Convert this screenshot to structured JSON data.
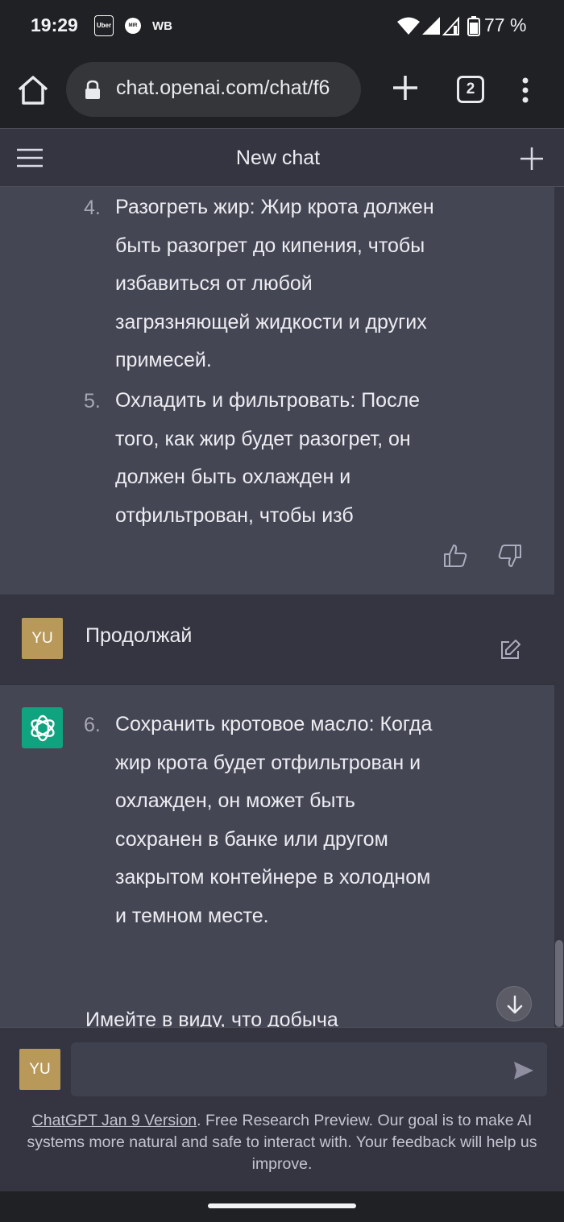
{
  "status_bar": {
    "time": "19:29",
    "notifications": [
      "Uber",
      "MIR",
      "WB"
    ],
    "battery": "77 %"
  },
  "browser": {
    "url": "chat.openai.com/chat/f6",
    "tab_count": "2"
  },
  "header": {
    "title": "New chat"
  },
  "conversation": {
    "ai_message_1": {
      "items": [
        {
          "num": "4.",
          "text": "Разогреть жир: Жир крота должен быть разогрет до кипения, чтобы избавиться от любой загрязняющей жидкости и других примесей."
        },
        {
          "num": "5.",
          "text": "Охладить и фильтровать: После того, как жир будет разогрет, он должен быть охлажден и отфильтрован, чтобы изб"
        }
      ]
    },
    "user_message": {
      "avatar": "YU",
      "text": "Продолжай"
    },
    "ai_message_2": {
      "items": [
        {
          "num": "6.",
          "text": "Сохранить кротовое масло: Когда жир крота будет отфильтрован и охлажден, он может быть сохранен в банке или другом закрытом контейнере в холодном и темном месте."
        }
      ],
      "partial": "Имейте в виду, что добыча"
    }
  },
  "composer": {
    "avatar": "YU",
    "placeholder": ""
  },
  "footer": {
    "link": "ChatGPT Jan 9 Version",
    "note": ". Free Research Preview. Our goal is to make AI systems more natural and safe to interact with. Your feedback will help us improve."
  }
}
